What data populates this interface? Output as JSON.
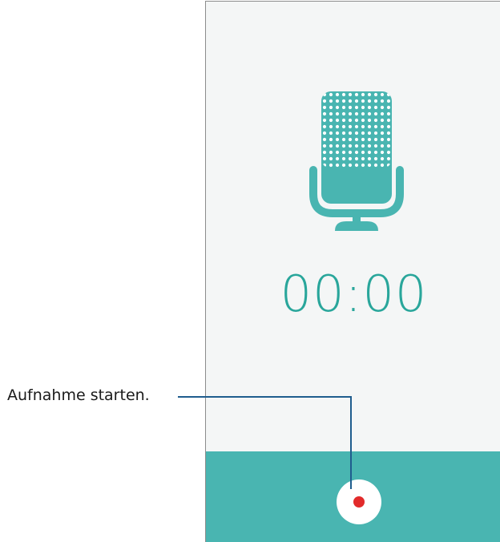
{
  "screen": {
    "timer": "00:00",
    "icons": {
      "microphone": "microphone-icon",
      "record": "record-dot-icon"
    },
    "colors": {
      "accent": "#4bb6b2",
      "record_dot": "#e22b2b",
      "background": "#f4f6f6"
    }
  },
  "callout": {
    "label": "Aufnahme starten."
  }
}
